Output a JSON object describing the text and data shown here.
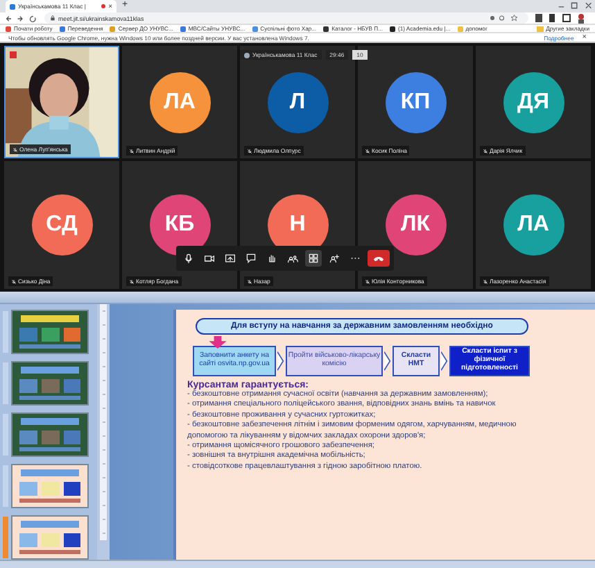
{
  "browser": {
    "tab_title": "Українськамова 11 Клас |",
    "tab_close": "×",
    "new_tab": "+",
    "url": "meet.jit.si/ukrainskamova11klas",
    "bookmarks": [
      {
        "label": "Почати роботу",
        "color": "#e04a3a"
      },
      {
        "label": "Переведення",
        "color": "#3b78d8"
      },
      {
        "label": "Сервер ДО УНУВС...",
        "color": "#e0a020"
      },
      {
        "label": "МВС/Сайты УНУВС...",
        "color": "#3b78d8"
      },
      {
        "label": "Суспільні фото Хар...",
        "color": "#4a8fe0"
      },
      {
        "label": "Каталог - НБУВ П...",
        "color": "#333333"
      },
      {
        "label": "(1) Academia.edu |...",
        "color": "#222222"
      },
      {
        "label": "допомог",
        "color": "#f0c040"
      }
    ],
    "other_bookmarks": "Другие закладки",
    "infobar": {
      "message": "Чтобы обновлять Google Chrome, нужна Windows 10 или более поздней версии. У вас установлена Windows 7.",
      "link": "Подробнее",
      "close": "×"
    }
  },
  "meeting": {
    "title": "Українськамова 11 Клас",
    "timer": "29:46",
    "participant_count": "10",
    "tiles": [
      {
        "kind": "video",
        "name": "Олена Луп'янська"
      },
      {
        "kind": "avatar",
        "initials": "ЛА",
        "color": "#f6923b",
        "name": "Литвин Андрій"
      },
      {
        "kind": "avatar",
        "initials": "Л",
        "color": "#0d5ca6",
        "name": "Людмила Олпурс"
      },
      {
        "kind": "avatar",
        "initials": "КП",
        "color": "#3d7fe0",
        "name": "Косик Поліна"
      },
      {
        "kind": "avatar",
        "initials": "ДЯ",
        "color": "#17a09e",
        "name": "Дарія Ялчик"
      },
      {
        "kind": "avatar",
        "initials": "СД",
        "color": "#f26b57",
        "name": "Сизько Діна"
      },
      {
        "kind": "avatar",
        "initials": "КБ",
        "color": "#e04577",
        "name": "Котляр Богдана"
      },
      {
        "kind": "avatar",
        "initials": "Н",
        "color": "#f26b57",
        "name": "Назар"
      },
      {
        "kind": "avatar",
        "initials": "ЛК",
        "color": "#e04577",
        "name": "Юлія Конторникова"
      },
      {
        "kind": "avatar",
        "initials": "ЛА",
        "color": "#17a09e",
        "name": "Лазоренко Анастасія"
      }
    ],
    "toolbar": [
      {
        "kind": "mic",
        "selected": false
      },
      {
        "kind": "camera",
        "selected": false
      },
      {
        "kind": "share",
        "selected": false
      },
      {
        "kind": "chat",
        "selected": false
      },
      {
        "kind": "hand",
        "selected": false
      },
      {
        "kind": "participants",
        "selected": false
      },
      {
        "kind": "tiles",
        "selected": true
      },
      {
        "kind": "invite",
        "selected": false
      },
      {
        "kind": "more",
        "selected": false
      },
      {
        "kind": "hangup",
        "selected": false
      }
    ]
  },
  "slides_panel": [
    {
      "selected": false
    },
    {
      "selected": false
    },
    {
      "selected": false
    },
    {
      "selected": false
    },
    {
      "selected": true
    }
  ],
  "slide": {
    "header": "Для вступу на навчання за державним замовленням необхідно",
    "steps": [
      {
        "kind": "light",
        "text": "Заповнити анкету на сайті osvita.np.gov.ua"
      },
      {
        "kind": "pale",
        "text": "Пройти військово-лікарську комісію"
      },
      {
        "kind": "plain",
        "text": "Скласти НМТ"
      },
      {
        "kind": "dark",
        "text": "Скласти іспит з фізичної підготовленості"
      }
    ],
    "guarantee_title": "Курсантам гарантується:",
    "guarantees": [
      "- безкоштовне отримання сучасної освіти (навчання за державним замовленням);",
      "- отримання спеціального поліцейського звання, відповідних знань вмінь та навичок",
      "- безкоштовне проживання у сучасних гуртожитках;",
      "- безкоштовне забезпечення літнім і зимовим форменим одягом, харчуванням, медичною допомогою та лікуванням у відомчих закладах охорони здоров'я;",
      "- отримання щомісячного грошового забезпечення;",
      "- зовнішня та внутрішня академічна мобільність;",
      "- стовідсоткове працевлаштування з гідною заробітною платою."
    ]
  }
}
